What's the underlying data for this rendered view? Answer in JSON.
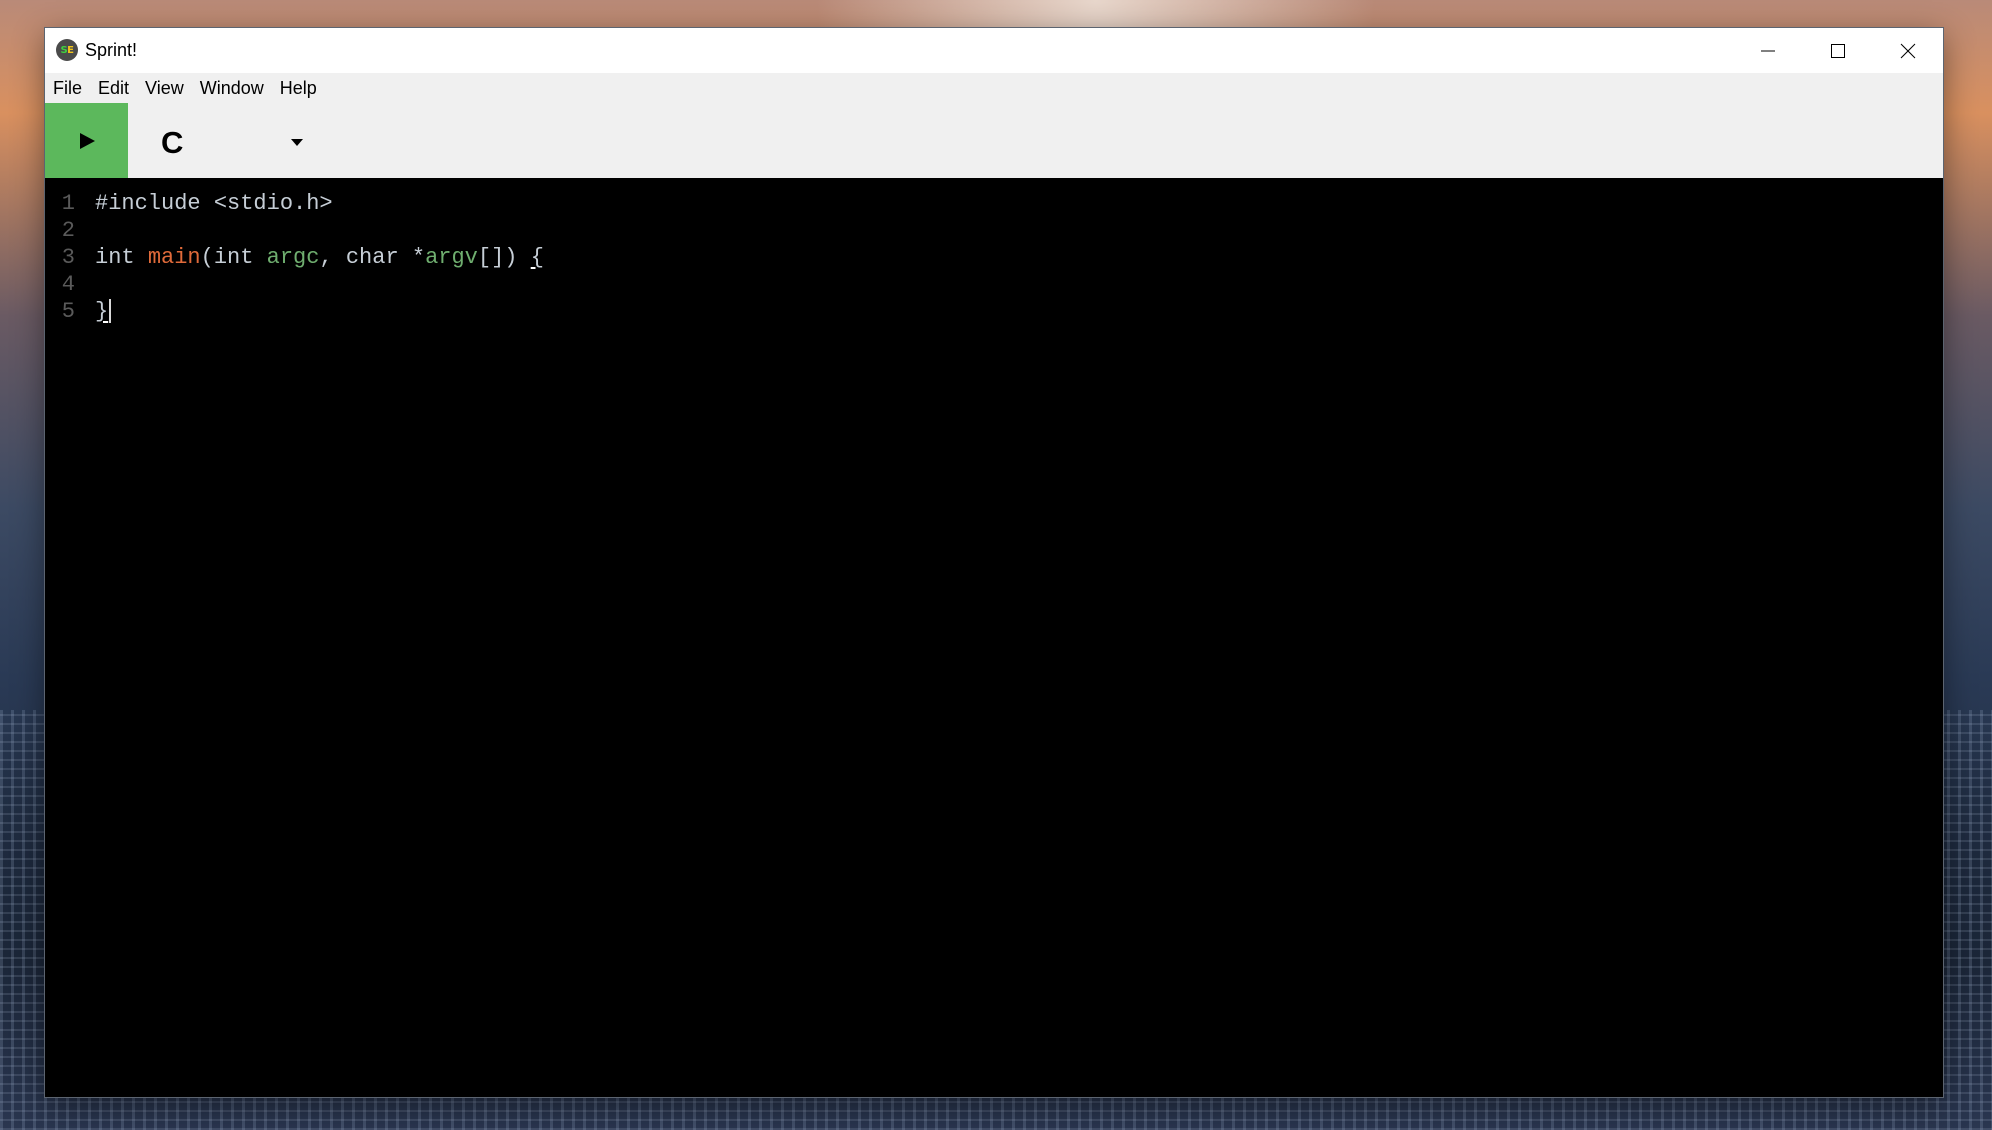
{
  "window": {
    "title": "Sprint!",
    "icon": {
      "name": "sprint-app-icon",
      "letters": [
        "S",
        "E"
      ],
      "colors": [
        "#3fd23f",
        "#f0c419"
      ]
    },
    "controls": [
      {
        "name": "minimize",
        "icon": "minimize-icon"
      },
      {
        "name": "maximize",
        "icon": "maximize-icon"
      },
      {
        "name": "close",
        "icon": "close-icon"
      }
    ]
  },
  "menubar": {
    "items": [
      {
        "label": "File"
      },
      {
        "label": "Edit"
      },
      {
        "label": "View"
      },
      {
        "label": "Window"
      },
      {
        "label": "Help"
      }
    ]
  },
  "toolbar": {
    "run_button": {
      "icon": "play-icon",
      "color": "#5cb85c"
    },
    "language": {
      "selected": "C",
      "icon": "dropdown-arrow-icon"
    }
  },
  "editor": {
    "colors": {
      "background": "#000000",
      "keyword": "#c6ced6",
      "function": "#e06a3a",
      "variable": "#6fae6f",
      "line_number": "#5a5a5a"
    },
    "lines": [
      {
        "number": "1",
        "tokens": [
          {
            "text": "#include <stdio.h>",
            "type": "plain"
          }
        ]
      },
      {
        "number": "2",
        "tokens": []
      },
      {
        "number": "3",
        "tokens": [
          {
            "text": "int ",
            "type": "plain"
          },
          {
            "text": "main",
            "type": "func"
          },
          {
            "text": "(int ",
            "type": "plain"
          },
          {
            "text": "argc",
            "type": "var"
          },
          {
            "text": ", char *",
            "type": "plain"
          },
          {
            "text": "argv",
            "type": "var"
          },
          {
            "text": "[]) ",
            "type": "plain"
          },
          {
            "text": "{",
            "type": "brace"
          }
        ]
      },
      {
        "number": "4",
        "tokens": []
      },
      {
        "number": "5",
        "tokens": [
          {
            "text": "}",
            "type": "brace"
          }
        ],
        "cursor": true
      }
    ]
  }
}
